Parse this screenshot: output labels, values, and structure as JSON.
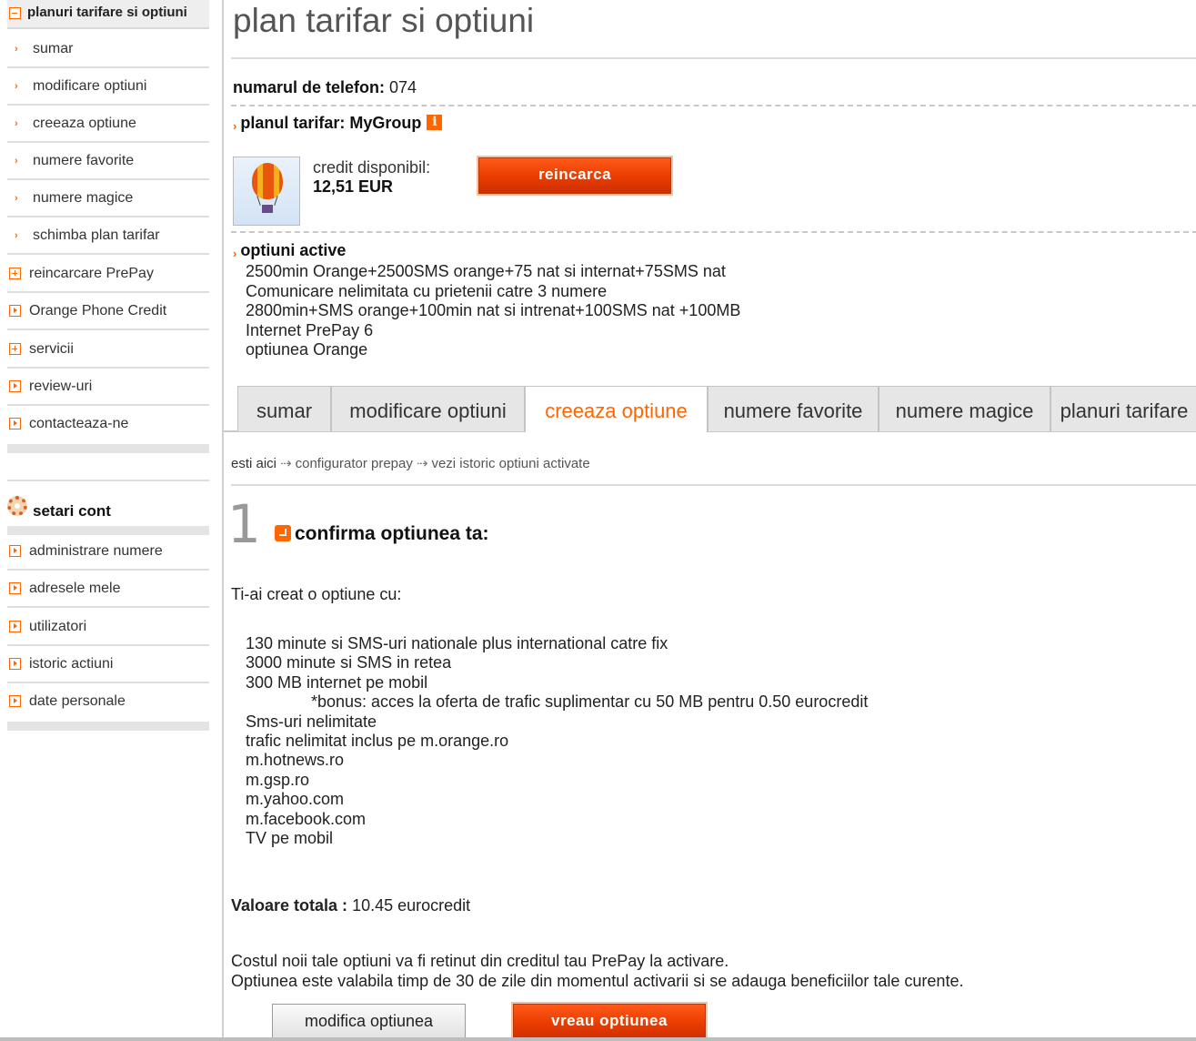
{
  "sidebar": {
    "section_title": "planuri tarifare si optiuni",
    "sub_items": [
      {
        "label": "sumar"
      },
      {
        "label": "modificare optiuni"
      },
      {
        "label": "creeaza optiune"
      },
      {
        "label": "numere favorite"
      },
      {
        "label": "numere magice"
      },
      {
        "label": "schimba plan tarifar"
      }
    ],
    "main_items": [
      {
        "label": "reincarcare PrePay",
        "icon": "plus-box-icon"
      },
      {
        "label": "Orange Phone Credit",
        "icon": "arrow-box-icon"
      },
      {
        "label": "servicii",
        "icon": "plus-box-icon"
      },
      {
        "label": "review-uri",
        "icon": "arrow-box-icon"
      },
      {
        "label": "contacteaza-ne",
        "icon": "arrow-box-icon"
      }
    ],
    "account_title": "setari cont",
    "account_items": [
      {
        "label": "administrare numere"
      },
      {
        "label": "adresele mele"
      },
      {
        "label": "utilizatori"
      },
      {
        "label": "istoric actiuni"
      },
      {
        "label": "date personale"
      }
    ]
  },
  "header": {
    "title": "plan tarifar si optiuni"
  },
  "account": {
    "phone_label": "numarul de telefon:",
    "phone_value": "074",
    "plan_label": "planul tarifar: MyGroup",
    "credit_label": "credit disponibil:",
    "credit_value": "12,51 EUR",
    "recharge_button": "reincarca"
  },
  "active_options": {
    "title": "optiuni active",
    "items": [
      "2500min Orange+2500SMS orange+75 nat si internat+75SMS nat",
      "Comunicare nelimitata cu prietenii catre 3 numere",
      "2800min+SMS orange+100min nat si intrenat+100SMS nat +100MB",
      "Internet PrePay 6",
      "optiunea Orange"
    ]
  },
  "tabs": [
    {
      "label": "sumar"
    },
    {
      "label": "modificare optiuni"
    },
    {
      "label": "creeaza optiune"
    },
    {
      "label": "numere favorite"
    },
    {
      "label": "numere magice"
    },
    {
      "label": "planuri tarifare"
    }
  ],
  "active_tab": "creeaza optiune",
  "breadcrumb": {
    "here": "esti aici",
    "items": [
      "configurator prepay",
      "vezi istoric optiuni activate"
    ]
  },
  "step": {
    "number": "1",
    "title": "confirma optiunea ta:"
  },
  "summary": {
    "intro": "Ti-ai creat o optiune cu:",
    "features": [
      "130 minute si SMS-uri nationale plus international catre fix",
      "3000 minute si SMS in retea",
      "300 MB internet pe mobil",
      "*bonus: acces la oferta de trafic suplimentar cu 50 MB pentru 0.50 eurocredit",
      "Sms-uri nelimitate",
      "trafic nelimitat inclus pe m.orange.ro",
      "m.hotnews.ro",
      "m.gsp.ro",
      "m.yahoo.com",
      "m.facebook.com",
      "TV pe mobil"
    ],
    "total_label": "Valoare totala :",
    "total_value": "10.45 eurocredit",
    "note_1": "Costul noii tale optiuni va fi retinut din creditul tau PrePay la activare.",
    "note_2": "Optiunea este valabila timp de 30 de zile din momentul activarii si se adauga beneficiilor tale curente."
  },
  "actions": {
    "modify_button": "modifica optiunea",
    "confirm_button": "vreau optiunea"
  },
  "colors": {
    "accent": "#ff6600",
    "button_red": "#e93c00",
    "tab_bg": "#e6e6e6"
  }
}
